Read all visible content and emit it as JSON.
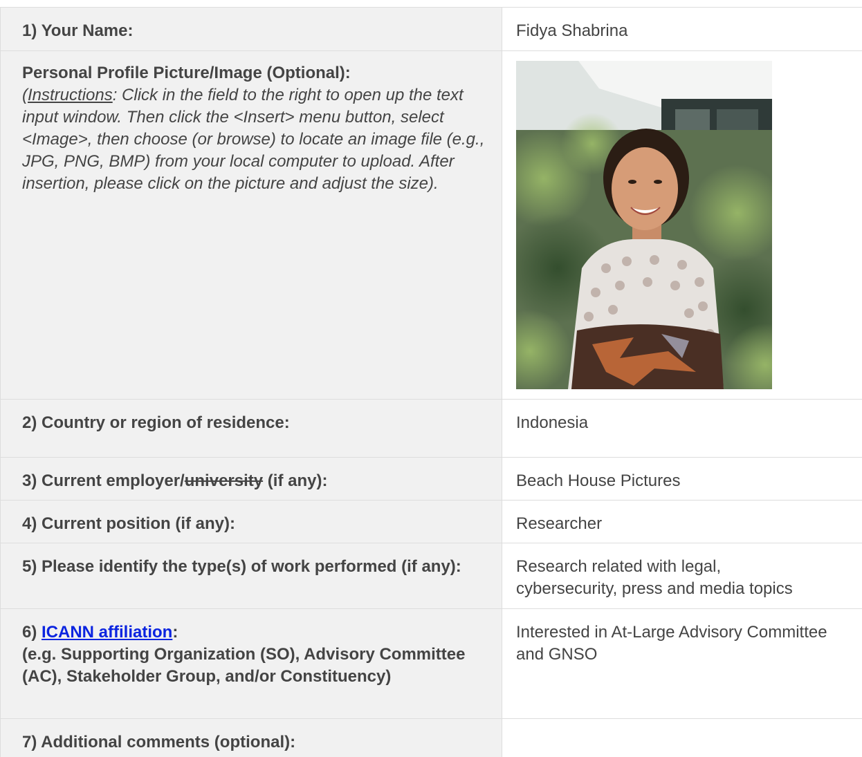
{
  "rows": {
    "name": {
      "label": "1) Your Name:",
      "value": "Fidya Shabrina"
    },
    "picture": {
      "label": "Personal Profile Picture/Image (Optional):",
      "instructions_open": "(",
      "instructions_word": "Instructions",
      "instructions_text": ": Click in the field to the right to open up the text input window. Then click the <Insert> menu button, select <Image>, then choose (or browse) to locate an image file (e.g., JPG, PNG, BMP) from your local computer to upload. After insertion, please click on the picture and adjust the size)."
    },
    "country": {
      "label": "2) Country or region of residence:",
      "value": "Indonesia"
    },
    "employer": {
      "label_prefix": "3) Current employer/",
      "label_struck": "university",
      "label_suffix": " (if any):",
      "value": "Beach House Pictures"
    },
    "position": {
      "label": "4) Current position (if any):",
      "value": "Researcher"
    },
    "work": {
      "label": "5) Please identify the type(s) of work performed (if any):",
      "value_line1": "Research related with legal,",
      "value_line2": "cybersecurity, press and media topics"
    },
    "affiliation": {
      "label_prefix": "6) ",
      "label_link": "ICANN affiliation",
      "label_suffix": ":",
      "label_detail": "(e.g. Supporting Organization (SO), Advisory Committee (AC), Stakeholder Group, and/or Constituency)",
      "value_prefix": "Interested in ",
      "value_rest": "At-Large Advisory Committee and GNSO"
    },
    "comments": {
      "label": "7) Additional comments (optional):",
      "value": ""
    }
  },
  "colors": {
    "label_bg": "#f1f1f1",
    "border": "#dddddd",
    "text": "#444444",
    "link": "#0b24e0"
  }
}
